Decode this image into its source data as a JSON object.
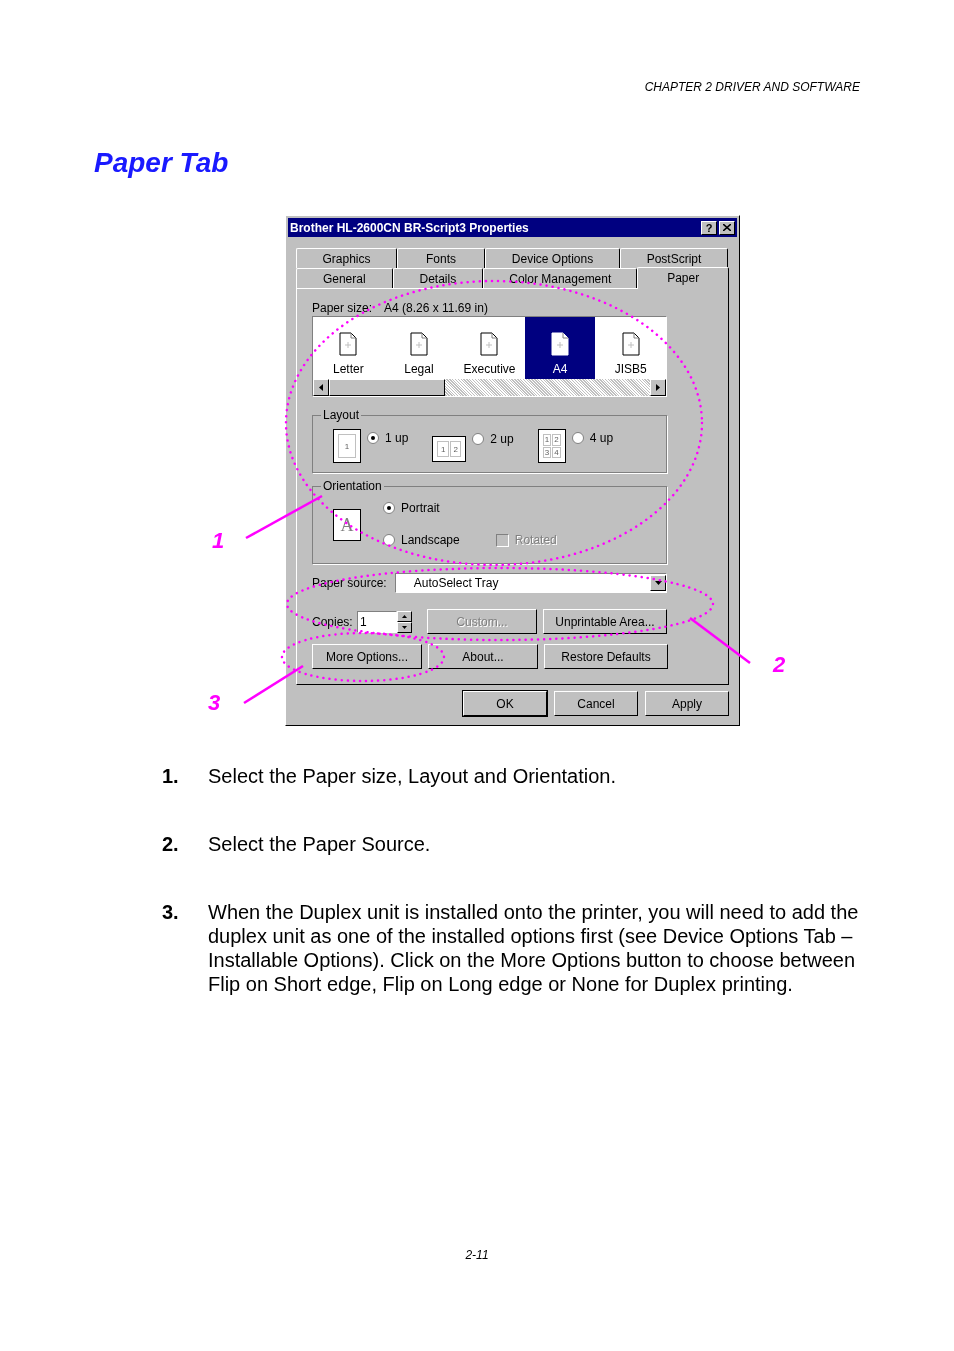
{
  "header": "CHAPTER 2 DRIVER AND SOFTWARE",
  "title": "Paper Tab",
  "dialog": {
    "title": "Brother HL-2600CN BR-Script3 Properties",
    "help_button": "?",
    "tab_rows": [
      [
        {
          "label": "Graphics",
          "selected": false
        },
        {
          "label": "Fonts",
          "selected": false
        },
        {
          "label": "Device Options",
          "selected": false
        },
        {
          "label": "PostScript",
          "selected": false
        }
      ],
      [
        {
          "label": "General",
          "selected": false
        },
        {
          "label": "Details",
          "selected": false
        },
        {
          "label": "Color Management",
          "selected": false
        },
        {
          "label": "Paper",
          "selected": true
        }
      ]
    ],
    "paper_size": {
      "label": "Paper size:",
      "value": "A4 (8.26 x 11.69 in)"
    },
    "papers": [
      {
        "label": "Letter",
        "selected": false
      },
      {
        "label": "Legal",
        "selected": false
      },
      {
        "label": "Executive",
        "selected": false
      },
      {
        "label": "A4",
        "selected": true
      },
      {
        "label": "JISB5",
        "selected": false
      }
    ],
    "layout": {
      "label": "Layout",
      "options": [
        {
          "label": "1 up",
          "selected": true,
          "icon_text": [
            "1"
          ]
        },
        {
          "label": "2 up",
          "selected": false,
          "icon_text": [
            "1",
            "2"
          ]
        },
        {
          "label": "4 up",
          "selected": false,
          "icon_text": [
            "1",
            "2",
            "3",
            "4"
          ]
        }
      ]
    },
    "orientation": {
      "label": "Orientation",
      "icon_text": "A",
      "options": [
        {
          "label": "Portrait",
          "selected": true
        },
        {
          "label": "Landscape",
          "selected": false
        }
      ],
      "rotated": {
        "label": "Rotated",
        "checked": false,
        "disabled": true
      }
    },
    "paper_source": {
      "label": "Paper source:",
      "value": "AutoSelect Tray"
    },
    "copies": {
      "label": "Copies:",
      "value": "1"
    },
    "buttons": [
      {
        "label": "Custom...",
        "disabled": true
      },
      {
        "label": "Unprintable Area...",
        "disabled": false
      },
      {
        "label": "More Options...",
        "disabled": false
      },
      {
        "label": "About...",
        "disabled": false
      },
      {
        "label": "Restore Defaults",
        "disabled": false
      }
    ],
    "footer_buttons": [
      {
        "label": "OK",
        "default": true
      },
      {
        "label": "Cancel",
        "default": false
      },
      {
        "label": "Apply",
        "default": false
      }
    ]
  },
  "callouts": [
    "1",
    "2",
    "3"
  ],
  "steps": [
    {
      "number": "1.",
      "text": "Select the Paper size, Layout and Orientation."
    },
    {
      "number": "2.",
      "text": "Select the Paper Source."
    },
    {
      "number": "3.",
      "text": "When the Duplex unit is installed onto the printer, you will need to add the duplex unit as one of the installed options first (see Device Options Tab – Installable Options).  Click on the More Options button to choose between Flip on Short edge, Flip on Long edge or None for Duplex printing."
    }
  ],
  "page_number": "2-11"
}
